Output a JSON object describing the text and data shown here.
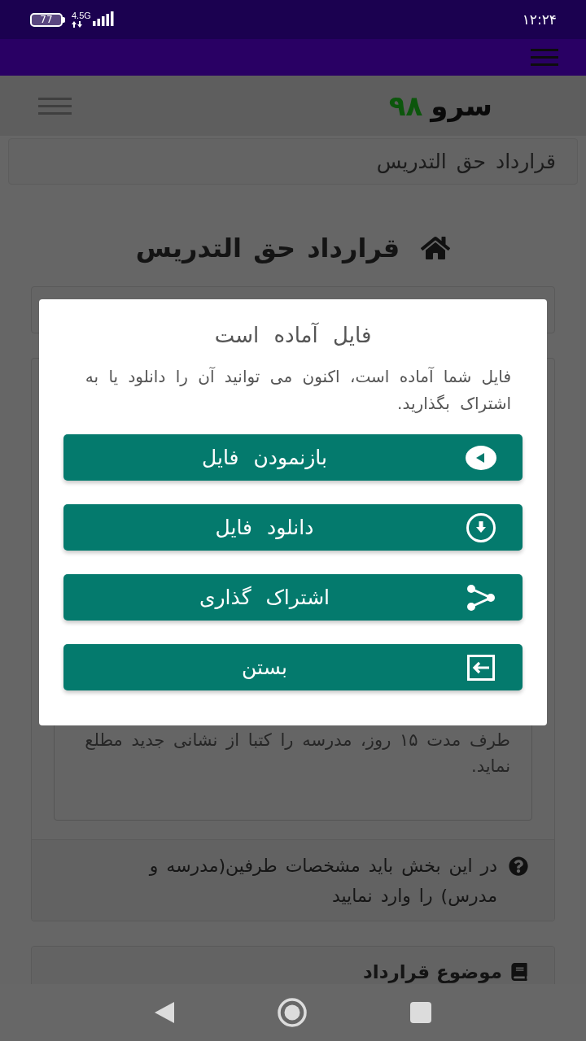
{
  "status_bar": {
    "battery": "77",
    "network": "4.5G",
    "time": "۱۲:۲۴"
  },
  "header": {
    "logo_text": "سرو",
    "logo_number": "۹۸"
  },
  "breadcrumb": "قرارداد حق التدریس",
  "page_title": "قرارداد حق التدریس",
  "contract_card": {
    "text_value": "طرف مدت ۱۵ روز، مدرسه را کتبا از نشانی جدید مطلع نماید.",
    "help_text": "در این بخش باید مشخصات طرفین(مدرسه و مدرس) را وارد نمایید"
  },
  "next_card": {
    "title": "موضوع قرارداد"
  },
  "dialog": {
    "title": "فایل آماده است",
    "message": "فایل شما آماده است، اکنون می توانید آن را دانلود یا به اشتراک بگذارید.",
    "buttons": [
      {
        "kind": "view",
        "label": "بازنمودن فایل"
      },
      {
        "kind": "download",
        "label": "دانلود فایل"
      },
      {
        "kind": "share",
        "label": "اشتراک گذاری"
      },
      {
        "kind": "close",
        "label": "بستن"
      }
    ]
  }
}
